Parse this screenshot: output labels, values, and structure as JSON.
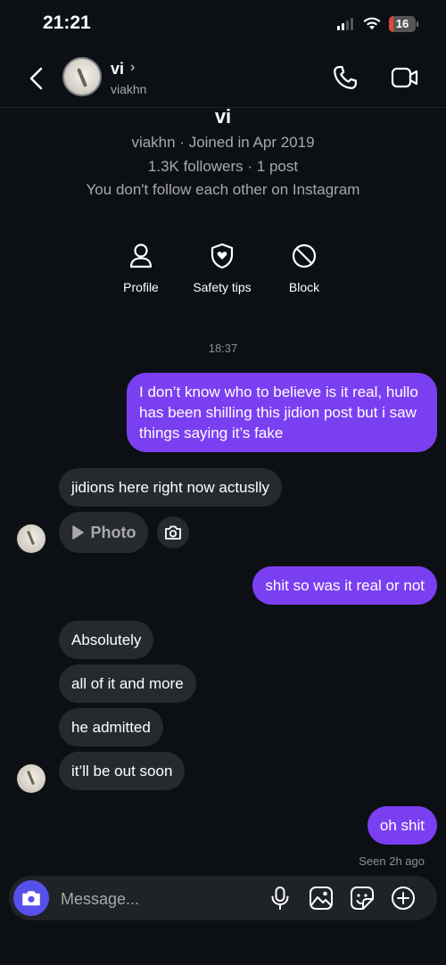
{
  "status_bar": {
    "time": "21:21",
    "battery": "16"
  },
  "header": {
    "name": "vi",
    "chevron": "›",
    "username": "viakhn"
  },
  "profile": {
    "name": "vi",
    "meta": "viakhn · Joined in Apr 2019",
    "stats": "1.3K followers · 1 post",
    "relation": "You don't follow each other on Instagram",
    "actions": [
      {
        "label": "Profile",
        "icon": "person-icon"
      },
      {
        "label": "Safety tips",
        "icon": "shield-heart-icon"
      },
      {
        "label": "Block",
        "icon": "block-icon"
      }
    ]
  },
  "thread": {
    "timestamp": "18:37",
    "messages": [
      {
        "side": "out",
        "text": "I don’t know who to believe is it real, hullo has been shilling this jidion post but i saw things saying it’s fake"
      },
      {
        "side": "in",
        "text": "jidions here right now actuslly"
      },
      {
        "side": "in",
        "text": "Photo",
        "kind": "photo"
      },
      {
        "side": "out",
        "text": "shit so was it real or not"
      },
      {
        "side": "in",
        "text": "Absolutely"
      },
      {
        "side": "in",
        "text": "all of it and more"
      },
      {
        "side": "in",
        "text": "he admitted"
      },
      {
        "side": "in",
        "text": "it’ll be out soon"
      },
      {
        "side": "out",
        "text": "oh shit"
      }
    ],
    "seen": "Seen 2h ago"
  },
  "composer": {
    "placeholder": "Message..."
  },
  "colors": {
    "background": "#0c1014",
    "outgoing_bubble": "#7b3ff2",
    "incoming_bubble": "#262a2f",
    "camera_button": "#5850ec"
  }
}
